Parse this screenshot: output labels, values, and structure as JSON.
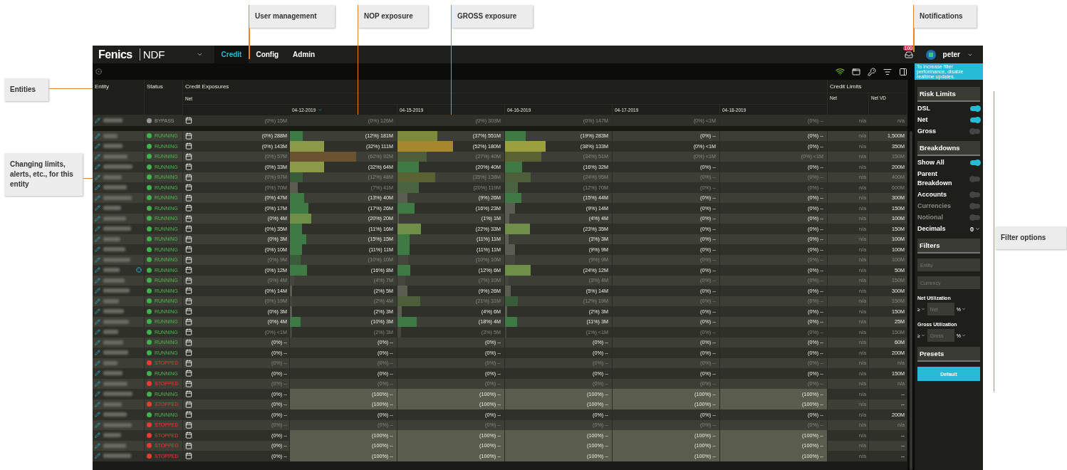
{
  "annotations": [
    {
      "text": "User management"
    },
    {
      "text": "NOP exposure"
    },
    {
      "text": "GROSS exposure"
    },
    {
      "text": "Notifications"
    },
    {
      "text": "Entities"
    },
    {
      "text": "Changing limits, alerts, etc., for this entity"
    },
    {
      "text": "Filter options"
    }
  ],
  "nav": {
    "logo": "Fenics",
    "product": "NDF",
    "tabs": [
      {
        "label": "Credit",
        "selected": true
      },
      {
        "label": "Config",
        "selected": false
      },
      {
        "label": "Admin",
        "selected": false
      }
    ],
    "notifications": "100",
    "user": "peter"
  },
  "table": {
    "headers": {
      "entity": "Entity",
      "status": "Status",
      "exposures": "Credit Exposures",
      "net": "Net",
      "limits": "Credit Limits",
      "limit_net": "Net",
      "limit_net_vd": "Net VD"
    },
    "dates": [
      {
        "label": "04-12-2019",
        "sorted": true
      },
      {
        "label": "04-15-2019",
        "sorted": false
      },
      {
        "label": "04-16-2019",
        "sorted": false
      },
      {
        "label": "04-17-2019",
        "sorted": false
      },
      {
        "label": "04-18-2019",
        "sorted": false
      }
    ],
    "pinned_row": {
      "status": "BYPASS",
      "kind": "bypass",
      "dimmed": true,
      "alert": false,
      "breached": false,
      "exposure": "(0%) 15M",
      "days": [
        {
          "text": "(0%) 126M"
        },
        {
          "text": "(0%) 303M"
        },
        {
          "text": "(0%) 147M"
        },
        {
          "text": "(0%) <1M"
        },
        {
          "text": "(0%) --"
        }
      ],
      "net": "n/a",
      "net_vd": "n/a"
    },
    "rows": [
      {
        "status": "RUNNING",
        "kind": "running",
        "dimmed": false,
        "alert": false,
        "breached": false,
        "exposure": "(0%) 288M",
        "days": [
          {
            "text": "(12%) 181M",
            "level": 0.12,
            "color": "#3f7a45"
          },
          {
            "text": "(37%) 551M",
            "level": 0.37,
            "color": "#7d8a3c"
          },
          {
            "text": "(19%) 283M",
            "level": 0.19,
            "color": "#3f7a45"
          },
          {
            "text": "(0%) --"
          },
          {
            "text": "(0%) --"
          }
        ],
        "net": "n/a",
        "net_vd": "1,500M"
      },
      {
        "status": "RUNNING",
        "kind": "running",
        "dimmed": false,
        "alert": false,
        "breached": false,
        "exposure": "(0%) 143M",
        "days": [
          {
            "text": "(32%) 111M",
            "level": 0.32,
            "color": "#8c9a48"
          },
          {
            "text": "(52%) 180M",
            "level": 0.52,
            "color": "#a8862e"
          },
          {
            "text": "(38%) 133M",
            "level": 0.38,
            "color": "#9aa040"
          },
          {
            "text": "(0%) <1M"
          },
          {
            "text": "(0%) --"
          }
        ],
        "net": "n/a",
        "net_vd": "350M"
      },
      {
        "status": "RUNNING",
        "kind": "running",
        "dimmed": true,
        "alert": false,
        "breached": false,
        "exposure": "(0%) 57M",
        "days": [
          {
            "text": "(62%) 92M",
            "level": 0.62,
            "color": "#6b5230"
          },
          {
            "text": "(27%) 40M",
            "level": 0.27,
            "color": "#4c5e3a"
          },
          {
            "text": "(34%) 51M",
            "level": 0.34,
            "color": "#5a6234"
          },
          {
            "text": "(0%) <1M"
          },
          {
            "text": "(0%) <1M"
          }
        ],
        "net": "n/a",
        "net_vd": "150M"
      },
      {
        "status": "RUNNING",
        "kind": "running",
        "dimmed": false,
        "alert": false,
        "breached": false,
        "exposure": "(0%) 33M",
        "days": [
          {
            "text": "(32%) 64M",
            "level": 0.32,
            "color": "#8c9a48"
          },
          {
            "text": "(20%) 40M",
            "level": 0.2,
            "color": "#3f7a45"
          },
          {
            "text": "(16%) 32M",
            "level": 0.16,
            "color": "#3f7a45"
          },
          {
            "text": "(0%) --"
          },
          {
            "text": "(0%) --"
          }
        ],
        "net": "n/a",
        "net_vd": "200M"
      },
      {
        "status": "RUNNING",
        "kind": "running",
        "dimmed": true,
        "alert": false,
        "breached": false,
        "exposure": "(0%) 97M",
        "days": [
          {
            "text": "(12%) 48M",
            "level": 0.12,
            "color": "#3a5c3a"
          },
          {
            "text": "(35%) 138M",
            "level": 0.35,
            "color": "#5a6234"
          },
          {
            "text": "(24%) 95M",
            "level": 0.24,
            "color": "#4c5e3a"
          },
          {
            "text": "(0%) --"
          },
          {
            "text": "(0%) --"
          }
        ],
        "net": "n/a",
        "net_vd": "400M"
      },
      {
        "status": "RUNNING",
        "kind": "running",
        "dimmed": true,
        "alert": false,
        "breached": false,
        "exposure": "(0%) 70M",
        "days": [
          {
            "text": "(7%) 41M",
            "level": 0.07,
            "color": "#5b5d52"
          },
          {
            "text": "(20%) 119M",
            "level": 0.2,
            "color": "#4a6442"
          },
          {
            "text": "(12%) 70M",
            "level": 0.12,
            "color": "#4a6442"
          },
          {
            "text": "(0%) --"
          },
          {
            "text": "(0%) --"
          }
        ],
        "net": "n/a",
        "net_vd": "600M"
      },
      {
        "status": "RUNNING",
        "kind": "running",
        "dimmed": false,
        "alert": false,
        "breached": false,
        "exposure": "(0%) 47M",
        "days": [
          {
            "text": "(13%) 40M",
            "level": 0.13,
            "color": "#3f7a45"
          },
          {
            "text": "(9%) 26M",
            "level": 0.09,
            "color": "#5b5d52"
          },
          {
            "text": "(15%) 44M",
            "level": 0.15,
            "color": "#3f7a45"
          },
          {
            "text": "(0%) --"
          },
          {
            "text": "(0%) --"
          }
        ],
        "net": "n/a",
        "net_vd": "300M"
      },
      {
        "status": "RUNNING",
        "kind": "running",
        "dimmed": false,
        "alert": false,
        "breached": false,
        "exposure": "(0%) 17M",
        "days": [
          {
            "text": "(17%) 26M",
            "level": 0.17,
            "color": "#3f7a45"
          },
          {
            "text": "(16%) 23M",
            "level": 0.16,
            "color": "#3f7a45"
          },
          {
            "text": "(9%) 14M",
            "level": 0.09,
            "color": "#5b5d52"
          },
          {
            "text": "(0%) --"
          },
          {
            "text": "(0%) --"
          }
        ],
        "net": "n/a",
        "net_vd": "150M"
      },
      {
        "status": "RUNNING",
        "kind": "running",
        "dimmed": false,
        "alert": false,
        "breached": false,
        "exposure": "(0%) 4M",
        "days": [
          {
            "text": "(20%) 20M",
            "level": 0.2,
            "color": "#6f8f48"
          },
          {
            "text": "(1%) 1M",
            "level": 0.01,
            "color": "#5b5d52"
          },
          {
            "text": "(4%) 4M",
            "level": 0.04,
            "color": "#5b5d52"
          },
          {
            "text": "(0%) --"
          },
          {
            "text": "(0%) --"
          }
        ],
        "net": "n/a",
        "net_vd": "100M"
      },
      {
        "status": "RUNNING",
        "kind": "running",
        "dimmed": false,
        "alert": false,
        "breached": false,
        "exposure": "(0%) 35M",
        "days": [
          {
            "text": "(11%) 16M",
            "level": 0.11,
            "color": "#3f7a45"
          },
          {
            "text": "(22%) 33M",
            "level": 0.22,
            "color": "#6f8f48"
          },
          {
            "text": "(23%) 35M",
            "level": 0.23,
            "color": "#6f8f48"
          },
          {
            "text": "(0%) --"
          },
          {
            "text": "(0%) --"
          }
        ],
        "net": "n/a",
        "net_vd": "150M"
      },
      {
        "status": "RUNNING",
        "kind": "running",
        "dimmed": false,
        "alert": false,
        "breached": false,
        "exposure": "(0%) 3M",
        "days": [
          {
            "text": "(15%) 15M",
            "level": 0.15,
            "color": "#3f7a45"
          },
          {
            "text": "(11%) 11M",
            "level": 0.11,
            "color": "#3f7a45"
          },
          {
            "text": "(3%) 3M",
            "level": 0.03,
            "color": "#5b5d52"
          },
          {
            "text": "(0%) --"
          },
          {
            "text": "(0%) --"
          }
        ],
        "net": "n/a",
        "net_vd": "100M"
      },
      {
        "status": "RUNNING",
        "kind": "running",
        "dimmed": false,
        "alert": false,
        "breached": false,
        "exposure": "(0%) 10M",
        "days": [
          {
            "text": "(11%) 11M",
            "level": 0.11,
            "color": "#3f7a45"
          },
          {
            "text": "(11%) 11M",
            "level": 0.11,
            "color": "#3f7a45"
          },
          {
            "text": "(9%) 9M",
            "level": 0.09,
            "color": "#5b5d52"
          },
          {
            "text": "(0%) --"
          },
          {
            "text": "(0%) --"
          }
        ],
        "net": "n/a",
        "net_vd": "100M"
      },
      {
        "status": "RUNNING",
        "kind": "running",
        "dimmed": true,
        "alert": false,
        "breached": false,
        "exposure": "(0%) 9M",
        "days": [
          {
            "text": "(10%) 10M",
            "level": 0.1,
            "color": "#3a5c3a"
          },
          {
            "text": "(10%) 10M",
            "level": 0.1,
            "color": "#45473f"
          },
          {
            "text": "(9%) 9M",
            "level": 0.09,
            "color": "#45473f"
          },
          {
            "text": "(0%) --"
          },
          {
            "text": "(0%) --"
          }
        ],
        "net": "n/a",
        "net_vd": "100M"
      },
      {
        "status": "RUNNING",
        "kind": "running",
        "dimmed": false,
        "alert": true,
        "breached": false,
        "exposure": "(0%) 12M",
        "days": [
          {
            "text": "(16%) 8M",
            "level": 0.16,
            "color": "#3f7a45"
          },
          {
            "text": "(12%) 6M",
            "level": 0.12,
            "color": "#3f7a45"
          },
          {
            "text": "(24%) 12M",
            "level": 0.24,
            "color": "#6f8f48"
          },
          {
            "text": "(0%) --"
          },
          {
            "text": "(0%) --"
          }
        ],
        "net": "n/a",
        "net_vd": "50M"
      },
      {
        "status": "RUNNING",
        "kind": "running",
        "dimmed": true,
        "alert": false,
        "breached": false,
        "exposure": "(0%) 4M",
        "days": [
          {
            "text": "(4%) 7M",
            "level": 0.04,
            "color": "#45473f"
          },
          {
            "text": "(7%) 10M",
            "level": 0.07,
            "color": "#45473f"
          },
          {
            "text": "(3%) 4M",
            "level": 0.03,
            "color": "#45473f"
          },
          {
            "text": "(0%) --"
          },
          {
            "text": "(0%) --"
          }
        ],
        "net": "n/a",
        "net_vd": "150M"
      },
      {
        "status": "RUNNING",
        "kind": "running",
        "dimmed": false,
        "alert": false,
        "breached": false,
        "exposure": "(0%) 14M",
        "days": [
          {
            "text": "(2%) 5M",
            "level": 0.02,
            "color": "#5b5d52"
          },
          {
            "text": "(9%) 26M",
            "level": 0.09,
            "color": "#5b5d52"
          },
          {
            "text": "(5%) 14M",
            "level": 0.05,
            "color": "#5b5d52"
          },
          {
            "text": "(0%) --"
          },
          {
            "text": "(0%) --"
          }
        ],
        "net": "n/a",
        "net_vd": "300M"
      },
      {
        "status": "RUNNING",
        "kind": "running",
        "dimmed": true,
        "alert": false,
        "breached": false,
        "exposure": "(0%) 19M",
        "days": [
          {
            "text": "(2%) 4M",
            "level": 0.02,
            "color": "#45473f"
          },
          {
            "text": "(21%) 31M",
            "level": 0.21,
            "color": "#4c5e3a"
          },
          {
            "text": "(12%) 19M",
            "level": 0.12,
            "color": "#3a5c3a"
          },
          {
            "text": "(0%) --"
          },
          {
            "text": "(0%) --"
          }
        ],
        "net": "n/a",
        "net_vd": "150M"
      },
      {
        "status": "RUNNING",
        "kind": "running",
        "dimmed": false,
        "alert": false,
        "breached": false,
        "exposure": "(0%) 3M",
        "days": [
          {
            "text": "(2%) 3M",
            "level": 0.02,
            "color": "#5b5d52"
          },
          {
            "text": "(4%) 6M",
            "level": 0.04,
            "color": "#5b5d52"
          },
          {
            "text": "(2%) 3M",
            "level": 0.02,
            "color": "#5b5d52"
          },
          {
            "text": "(0%) --"
          },
          {
            "text": "(0%) --"
          }
        ],
        "net": "n/a",
        "net_vd": "150M"
      },
      {
        "status": "RUNNING",
        "kind": "running",
        "dimmed": false,
        "alert": false,
        "breached": false,
        "exposure": "(0%) 4M",
        "days": [
          {
            "text": "(10%) 3M",
            "level": 0.1,
            "color": "#3f7a45"
          },
          {
            "text": "(18%) 4M",
            "level": 0.18,
            "color": "#3f7a45"
          },
          {
            "text": "(11%) 3M",
            "level": 0.11,
            "color": "#3f7a45"
          },
          {
            "text": "(0%) --"
          },
          {
            "text": "(0%) --"
          }
        ],
        "net": "n/a",
        "net_vd": "25M"
      },
      {
        "status": "RUNNING",
        "kind": "running",
        "dimmed": true,
        "alert": false,
        "breached": false,
        "exposure": "(0%) <1M",
        "days": [
          {
            "text": "(2%) 3M",
            "level": 0.02,
            "color": "#45473f"
          },
          {
            "text": "(3%) 5M",
            "level": 0.03,
            "color": "#45473f"
          },
          {
            "text": "(1%) <1M",
            "level": 0.01,
            "color": "#45473f"
          },
          {
            "text": "(0%) --"
          },
          {
            "text": "(0%) --"
          }
        ],
        "net": "n/a",
        "net_vd": "150M"
      },
      {
        "status": "RUNNING",
        "kind": "running",
        "dimmed": false,
        "alert": false,
        "breached": false,
        "exposure": "(0%) --",
        "days": [
          {
            "text": "(0%) --"
          },
          {
            "text": "(0%) --"
          },
          {
            "text": "(0%) --"
          },
          {
            "text": "(0%) --"
          },
          {
            "text": "(0%) --"
          }
        ],
        "net": "n/a",
        "net_vd": "60M"
      },
      {
        "status": "RUNNING",
        "kind": "running",
        "dimmed": false,
        "alert": false,
        "breached": false,
        "exposure": "(0%) --",
        "days": [
          {
            "text": "(0%) --"
          },
          {
            "text": "(0%) --"
          },
          {
            "text": "(0%) --"
          },
          {
            "text": "(0%) --"
          },
          {
            "text": "(0%) --"
          }
        ],
        "net": "n/a",
        "net_vd": "200M"
      },
      {
        "status": "STOPPED",
        "kind": "stopped",
        "dimmed": true,
        "alert": false,
        "breached": false,
        "exposure": "(0%) --",
        "days": [
          {
            "text": "(0%) --"
          },
          {
            "text": "(0%) --"
          },
          {
            "text": "(0%) --"
          },
          {
            "text": "(0%) --"
          },
          {
            "text": "(0%) --"
          }
        ],
        "net": "n/a",
        "net_vd": "n/a"
      },
      {
        "status": "RUNNING",
        "kind": "running",
        "dimmed": false,
        "alert": false,
        "breached": false,
        "exposure": "(0%) --",
        "days": [
          {
            "text": "(0%) --"
          },
          {
            "text": "(0%) --"
          },
          {
            "text": "(0%) --"
          },
          {
            "text": "(0%) --"
          },
          {
            "text": "(0%) --"
          }
        ],
        "net": "n/a",
        "net_vd": "150M"
      },
      {
        "status": "STOPPED",
        "kind": "stopped",
        "dimmed": true,
        "alert": false,
        "breached": false,
        "exposure": "(0%) --",
        "days": [
          {
            "text": "(0%) --"
          },
          {
            "text": "(0%) --"
          },
          {
            "text": "(0%) --"
          },
          {
            "text": "(0%) --"
          },
          {
            "text": "(0%) --"
          }
        ],
        "net": "n/a",
        "net_vd": "n/a"
      },
      {
        "status": "RUNNING",
        "kind": "running",
        "dimmed": false,
        "alert": false,
        "breached": true,
        "exposure": "(0%) --",
        "days": [
          {
            "text": "(100%) --"
          },
          {
            "text": "(100%) --"
          },
          {
            "text": "(100%) --"
          },
          {
            "text": "(100%) --"
          },
          {
            "text": "(100%) --"
          }
        ],
        "net": "n/a",
        "net_vd": "--"
      },
      {
        "status": "STOPPED",
        "kind": "stopped",
        "dimmed": false,
        "alert": false,
        "breached": true,
        "exposure": "(0%) --",
        "days": [
          {
            "text": "(100%) --"
          },
          {
            "text": "(100%) --"
          },
          {
            "text": "(100%) --"
          },
          {
            "text": "(100%) --"
          },
          {
            "text": "(100%) --"
          }
        ],
        "net": "n/a",
        "net_vd": "--"
      },
      {
        "status": "RUNNING",
        "kind": "running",
        "dimmed": false,
        "alert": false,
        "breached": false,
        "exposure": "(0%) --",
        "days": [
          {
            "text": "(0%) --"
          },
          {
            "text": "(0%) --"
          },
          {
            "text": "(0%) --"
          },
          {
            "text": "(0%) --"
          },
          {
            "text": "(0%) --"
          }
        ],
        "net": "n/a",
        "net_vd": "200M"
      },
      {
        "status": "STOPPED",
        "kind": "stopped",
        "dimmed": true,
        "alert": false,
        "breached": false,
        "exposure": "(0%) --",
        "days": [
          {
            "text": "(0%) --"
          },
          {
            "text": "(0%) --"
          },
          {
            "text": "(0%) --"
          },
          {
            "text": "(0%) --"
          },
          {
            "text": "(0%) --"
          }
        ],
        "net": "n/a",
        "net_vd": "n/a"
      },
      {
        "status": "STOPPED",
        "kind": "stopped",
        "dimmed": false,
        "alert": false,
        "breached": true,
        "exposure": "(0%) --",
        "days": [
          {
            "text": "(100%) --"
          },
          {
            "text": "(100%) --"
          },
          {
            "text": "(100%) --"
          },
          {
            "text": "(100%) --"
          },
          {
            "text": "(100%) --"
          }
        ],
        "net": "n/a",
        "net_vd": "--"
      },
      {
        "status": "STOPPED",
        "kind": "stopped",
        "dimmed": false,
        "alert": false,
        "breached": true,
        "exposure": "(0%) --",
        "days": [
          {
            "text": "(100%) --"
          },
          {
            "text": "(100%) --"
          },
          {
            "text": "(100%) --"
          },
          {
            "text": "(100%) --"
          },
          {
            "text": "(100%) --"
          }
        ],
        "net": "n/a",
        "net_vd": "--"
      },
      {
        "status": "STOPPED",
        "kind": "stopped",
        "dimmed": false,
        "alert": false,
        "breached": true,
        "exposure": "(0%) --",
        "days": [
          {
            "text": "(100%) --"
          },
          {
            "text": "(100%) --"
          },
          {
            "text": "(100%) --"
          },
          {
            "text": "(100%) --"
          },
          {
            "text": "(100%) --"
          }
        ],
        "net": "n/a",
        "net_vd": "--"
      }
    ]
  },
  "sidebar": {
    "notice": "To increase filter performance, disable realtime updates.",
    "sections": [
      {
        "title": "Risk Limits",
        "items": [
          {
            "kind": "toggle",
            "label": "DSL",
            "on": true,
            "disabled": false
          },
          {
            "kind": "toggle",
            "label": "Net",
            "on": true,
            "disabled": false
          },
          {
            "kind": "toggle",
            "label": "Gross",
            "on": false,
            "disabled": false
          }
        ]
      },
      {
        "title": "Breakdowns",
        "items": [
          {
            "kind": "toggle",
            "label": "Show All",
            "on": true,
            "disabled": false
          },
          {
            "kind": "toggle",
            "label": "Parent Breakdown",
            "on": false,
            "disabled": false
          },
          {
            "kind": "toggle",
            "label": "Accounts",
            "on": false,
            "disabled": false
          },
          {
            "kind": "toggle",
            "label": "Currencies",
            "on": false,
            "disabled": true
          },
          {
            "kind": "toggle",
            "label": "Notional",
            "on": false,
            "disabled": true
          },
          {
            "kind": "select",
            "label": "Decimals",
            "value": "0"
          }
        ]
      },
      {
        "title": "Filters",
        "items": [
          {
            "kind": "input",
            "placeholder": "Entity"
          },
          {
            "kind": "input",
            "placeholder": "Currency"
          },
          {
            "kind": "range",
            "label": "Net Utilization",
            "operator": "≥",
            "placeholder": "Net",
            "unit": "%"
          },
          {
            "kind": "range",
            "label": "Gross Utilization",
            "operator": "≥",
            "placeholder": "Gross",
            "unit": "%"
          }
        ]
      },
      {
        "title": "Presets",
        "items": [
          {
            "kind": "button",
            "label": "Default"
          }
        ]
      }
    ]
  }
}
